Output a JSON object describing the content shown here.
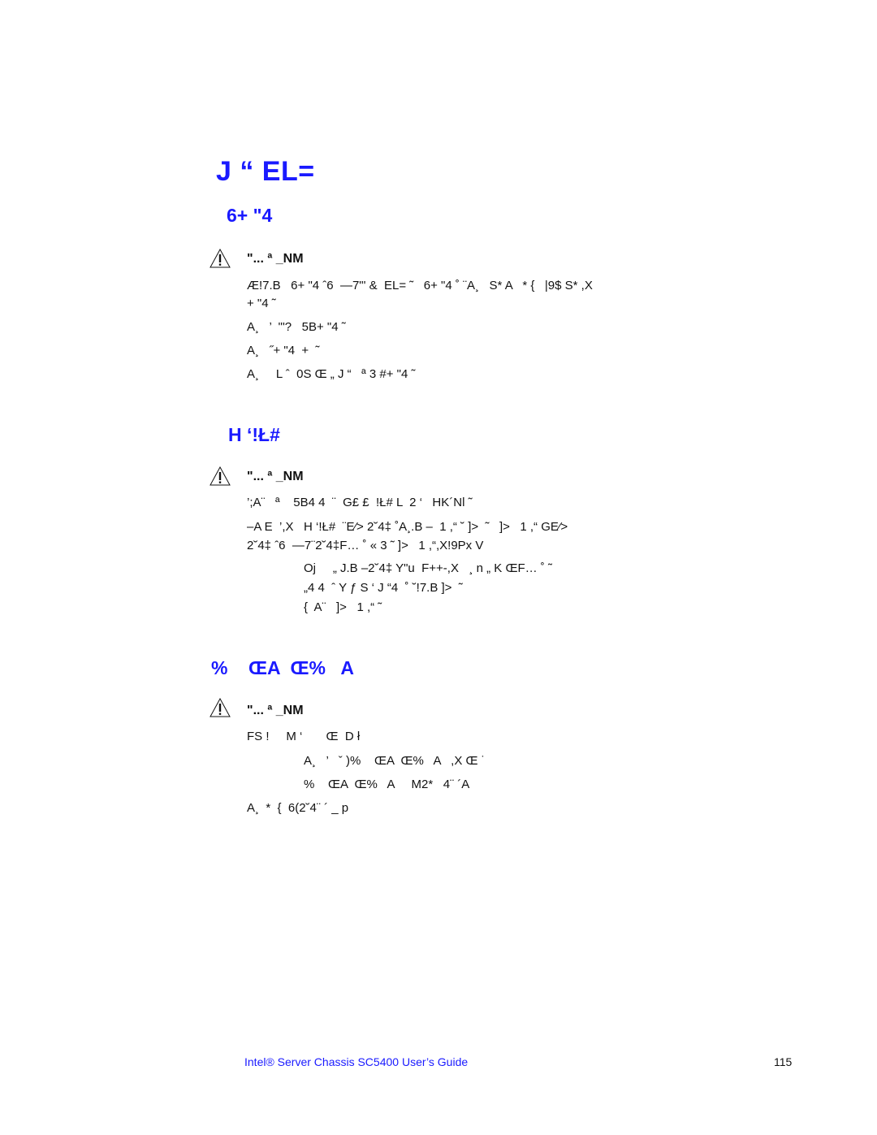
{
  "chapter_title": "J “ EL=",
  "sections": [
    {
      "heading": "6+ \"4",
      "warning_title": "\"... ª _NM",
      "lines": [
        "Æ!7.B   6+ \"4 ˆ6  —7\"' &  EL= ˜   6+ \"4 ˚ ¨A¸   S* A   * {   |9$ S* ,X",
        "+ \"4 ˜",
        "A¸   ’  \"'?   5B+ \"4 ˜",
        "A¸   ˝+ \"4  +  ˜",
        "A¸     L ˆ  0S Œ „ J “   ª 3 #+ \"4 ˜"
      ]
    },
    {
      "heading": "H ‘!Ł#",
      "warning_title": "\"... ª _NM",
      "lines": [
        "’;A¨   ª    5B4 4  ¨  G£ £  !Ł# L  2 ‘   HK´Nl ˜",
        "–A E  ’,X   H ‘!Ł#  ¨E⁄> 2˘4‡ ˚A¸.B –  1 ,“ ˘ ]>  ˜   ]>   1 ,“ GE⁄>",
        "2˘4‡ ˆ6  —7¨2˘4‡F… ˚ « 3 ˜ ]>   1 ,“,X!9Px V",
        "Oj     „ J.B –2˘4‡ Y\"u  F++-,X   ¸ n „ K ŒF… ˚ ˜",
        "„4 4  ˆ Y ƒ S ‘ J “4  ˚ ˘!7.B ]>  ˜",
        "{  A¨   ]>   1 ,“ ˜"
      ]
    },
    {
      "heading": "%    ŒA  Œ%   A",
      "warning_title": "\"... ª _NM",
      "lines": [
        "FS !     M ‘       Œ  D ł",
        "A¸   ’   ˇ )%    ŒA  Œ%   A   ,X Œ ˙",
        "%    ŒA  Œ%   A     M2*   4¨ ´A",
        "A¸  *  {  6(2˘4¨ ´ _ p"
      ]
    }
  ],
  "footer": {
    "guide_title": "Intel® Server Chassis SC5400 User’s Guide",
    "page_number": "115"
  },
  "colors": {
    "heading": "#1a1aff",
    "text": "#111111"
  }
}
